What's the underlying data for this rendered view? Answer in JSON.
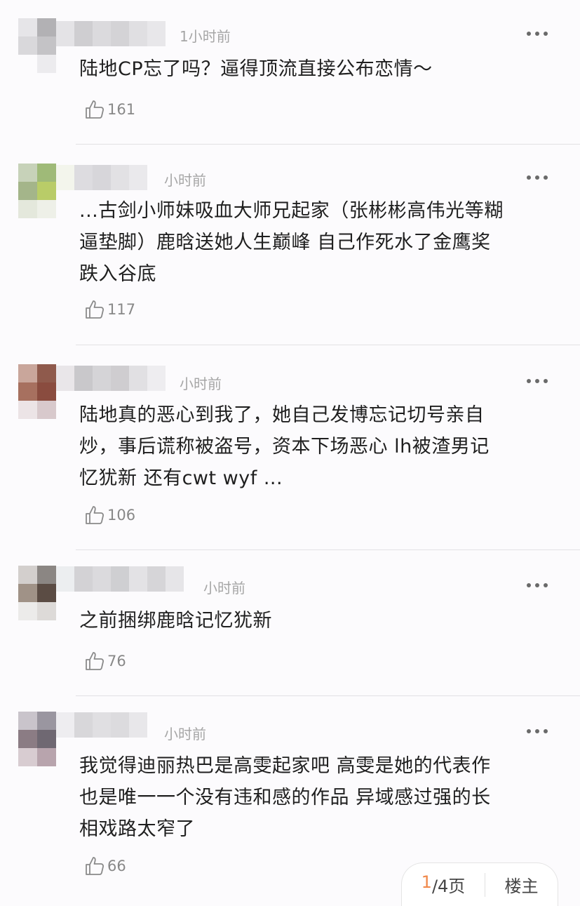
{
  "colors": {
    "background": "#fcfbfd",
    "text": "#1f1f1f",
    "meta": "#a6a6a6",
    "like": "#888888",
    "divider": "#e2e1e4",
    "pager_current": "#f0884a"
  },
  "comments": [
    {
      "time": "1小时前",
      "lines": [
        "陆地CP忘了吗？逼得顶流直接公布恋情～"
      ],
      "likes": "161",
      "more_icon": "ellipsis-icon",
      "like_icon": "thumbs-up-icon"
    },
    {
      "time": "小时前",
      "lines": [
        "...古剑小师妹吸血大师兄起家（张彬彬高伟光等糊",
        "逼垫脚）鹿晗送她人生巅峰 自己作死水了金鹰奖",
        "跌入谷底"
      ],
      "likes": "117",
      "more_icon": "ellipsis-icon",
      "like_icon": "thumbs-up-icon"
    },
    {
      "time": "小时前",
      "lines": [
        "陆地真的恶心到我了，她自己发博忘记切号亲自",
        "炒，事后谎称被盗号，资本下场恶心  lh被渣男记",
        "忆犹新  还有cwt wyf ..."
      ],
      "likes": "106",
      "more_icon": "ellipsis-icon",
      "like_icon": "thumbs-up-icon"
    },
    {
      "time": "小时前",
      "lines": [
        "之前捆绑鹿晗记忆犹新"
      ],
      "likes": "76",
      "more_icon": "ellipsis-icon",
      "like_icon": "thumbs-up-icon"
    },
    {
      "time": "小时前",
      "lines": [
        "我觉得迪丽热巴是高雯起家吧 高雯是她的代表作",
        "也是唯一一个没有违和感的作品 异域感过强的长",
        "相戏路太窄了"
      ],
      "likes": "66",
      "more_icon": "ellipsis-icon",
      "like_icon": "thumbs-up-icon"
    }
  ],
  "pager": {
    "current": "1",
    "total": "/4页",
    "op_label": "楼主"
  }
}
